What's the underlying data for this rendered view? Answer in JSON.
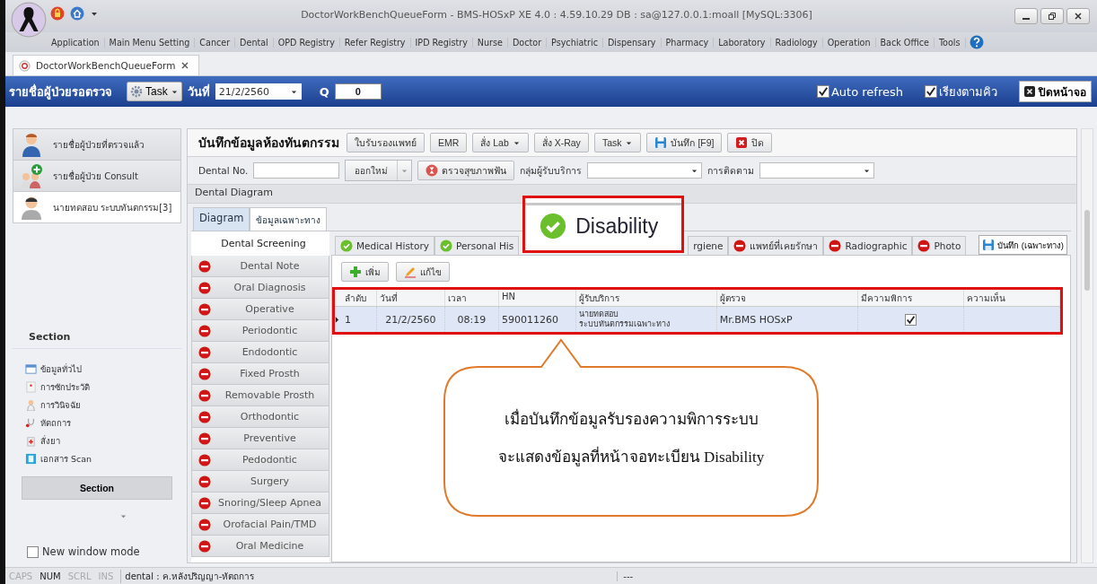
{
  "window": {
    "title": "DoctorWorkBenchQueueForm - BMS-HOSxP XE 4.0 : 4.59.10.29 DB : sa@127.0.0.1:moall [MySQL:3306]"
  },
  "menu": [
    "Application",
    "Main Menu Setting",
    "Cancer",
    "Dental",
    "OPD Registry",
    "Refer Registry",
    "IPD Registry",
    "Nurse",
    "Doctor",
    "Psychiatric",
    "Dispensary",
    "Pharmacy",
    "Laboratory",
    "Radiology",
    "Operation",
    "Back Office",
    "Tools"
  ],
  "doc_tabs": [
    {
      "label": "DoctorWorkBenchQueueForm",
      "selected": true
    }
  ],
  "queue_bar": {
    "title": "รายชื่อผู้ป่วยรอตรวจ",
    "task": "Task",
    "date_label": "วันที่",
    "date": "21/2/2560",
    "q_label": "Q",
    "q": "0",
    "close": "ปิดหน้าจอ",
    "options": [
      {
        "label": "Auto refresh",
        "checked": true
      },
      {
        "label": "เรียงตามคิว",
        "checked": true
      }
    ]
  },
  "patient_nav": [
    {
      "label": "รายชื่อผู้ป่วยที่ตรวจแล้ว",
      "kind": "doctor",
      "selected": false
    },
    {
      "label": "รายชื่อผู้ป่วย Consult",
      "kind": "consult",
      "selected": false
    },
    {
      "label": "นายทดสอบ ระบบทันตกรรม[3]",
      "kind": "patient",
      "selected": true
    }
  ],
  "section": {
    "title": "Section",
    "button": "Section",
    "items": [
      {
        "label": "ข้อมูลทั่วไป",
        "kind": "card"
      },
      {
        "label": "การซักประวัติ",
        "kind": "history"
      },
      {
        "label": "การวินิจฉัย",
        "kind": "doctor"
      },
      {
        "label": "หัตถการ",
        "kind": "stethoscope"
      },
      {
        "label": "สั่งยา",
        "kind": "drug"
      },
      {
        "label": "เอกสาร Scan",
        "kind": "scan"
      }
    ]
  },
  "new_window_mode": {
    "label": "New window mode",
    "checked": false
  },
  "form": {
    "title": "บันทึกข้อมูลห้องทันตกรรม",
    "buttons": [
      {
        "label": "ใบรับรองแพทย์",
        "kind": "plain"
      },
      {
        "label": "EMR",
        "kind": "plain"
      },
      {
        "label": "สั่ง Lab",
        "kind": "dropdown"
      },
      {
        "label": "สั่ง X-Ray",
        "kind": "plain"
      },
      {
        "label": "Task",
        "kind": "dropdown"
      },
      {
        "label": "บันทึก [F9]",
        "kind": "save"
      },
      {
        "label": "ปิด",
        "kind": "close"
      }
    ],
    "dental_no_label": "Dental No.",
    "new_no": "ออกใหม่",
    "checkup": "ตรวจสุขภาพฟัน",
    "group_label": "กลุ่มผู้รับบริการ",
    "follow_label": "การติดตาม"
  },
  "diagram": {
    "title": "Dental Diagram",
    "tabs": [
      {
        "label": "Diagram",
        "selected": false
      },
      {
        "label": "ข้อมูลเฉพาะทาง",
        "selected": true
      }
    ]
  },
  "sections": [
    {
      "label": "Dental Screening",
      "kind": "plain",
      "selected": true
    },
    {
      "label": "Dental Note",
      "kind": "missing",
      "selected": false
    },
    {
      "label": "Oral Diagnosis",
      "kind": "missing",
      "selected": false
    },
    {
      "label": "Operative",
      "kind": "missing",
      "selected": false
    },
    {
      "label": "Periodontic",
      "kind": "missing",
      "selected": false
    },
    {
      "label": "Endodontic",
      "kind": "missing",
      "selected": false
    },
    {
      "label": "Fixed Prosth",
      "kind": "missing",
      "selected": false
    },
    {
      "label": "Removable Prosth",
      "kind": "missing",
      "selected": false
    },
    {
      "label": "Orthodontic",
      "kind": "missing",
      "selected": false
    },
    {
      "label": "Preventive",
      "kind": "missing",
      "selected": false
    },
    {
      "label": "Pedodontic",
      "kind": "missing",
      "selected": false
    },
    {
      "label": "Surgery",
      "kind": "missing",
      "selected": false
    },
    {
      "label": "Snoring/Sleep Apnea",
      "kind": "missing",
      "selected": false
    },
    {
      "label": "Orofacial Pain/TMD",
      "kind": "missing",
      "selected": false
    },
    {
      "label": "Oral Medicine",
      "kind": "missing",
      "selected": false
    }
  ],
  "screening_tabs": [
    {
      "label": "Medical History",
      "kind": "done",
      "selected": false
    },
    {
      "label": "Personal His",
      "kind": "done",
      "selected": false
    },
    {
      "label": "rgiene",
      "kind": "plain",
      "selected": false
    },
    {
      "label": "แพทย์ที่เคยรักษา",
      "kind": "missing",
      "selected": false
    },
    {
      "label": "Radiographic",
      "kind": "missing",
      "selected": false
    },
    {
      "label": "Photo",
      "kind": "missing",
      "selected": false
    }
  ],
  "save_specific": "บันทึก (เฉพาะทาง)",
  "grid_buttons": [
    {
      "label": "เพิ่ม",
      "kind": "add"
    },
    {
      "label": "แก้ไข",
      "kind": "edit"
    }
  ],
  "table": {
    "columns": [
      "ลำดับ",
      "วันที่",
      "เวลา",
      "HN",
      "ผู้รับบริการ",
      "ผู้ตรวจ",
      "มีความพิการ",
      "ความเห็น"
    ],
    "rows": [
      {
        "no": "1",
        "date": "21/2/2560",
        "time": "08:19",
        "hn": "590011260",
        "patient": [
          "นายทดสอบ",
          "ระบบทันตกรรมเฉพาะทาง"
        ],
        "examiner": "Mr.BMS HOSxP",
        "disability": true,
        "selected": true
      }
    ]
  },
  "callout": {
    "tab": {
      "label": "Disability",
      "kind": "done"
    },
    "note": [
      "เมื่อบันทึกข้อมูลรับรองความพิการระบบ",
      "จะแสดงข้อมูลที่หน้าจอทะเบียน Disability"
    ]
  },
  "status_bar": {
    "keys": [
      {
        "label": "CAPS",
        "on": false
      },
      {
        "label": "NUM",
        "on": true
      },
      {
        "label": "SCRL",
        "on": false
      },
      {
        "label": "INS",
        "on": false
      }
    ],
    "text": "dental : ค.หลังปริญญา-หัตถการ",
    "extra": "---"
  }
}
